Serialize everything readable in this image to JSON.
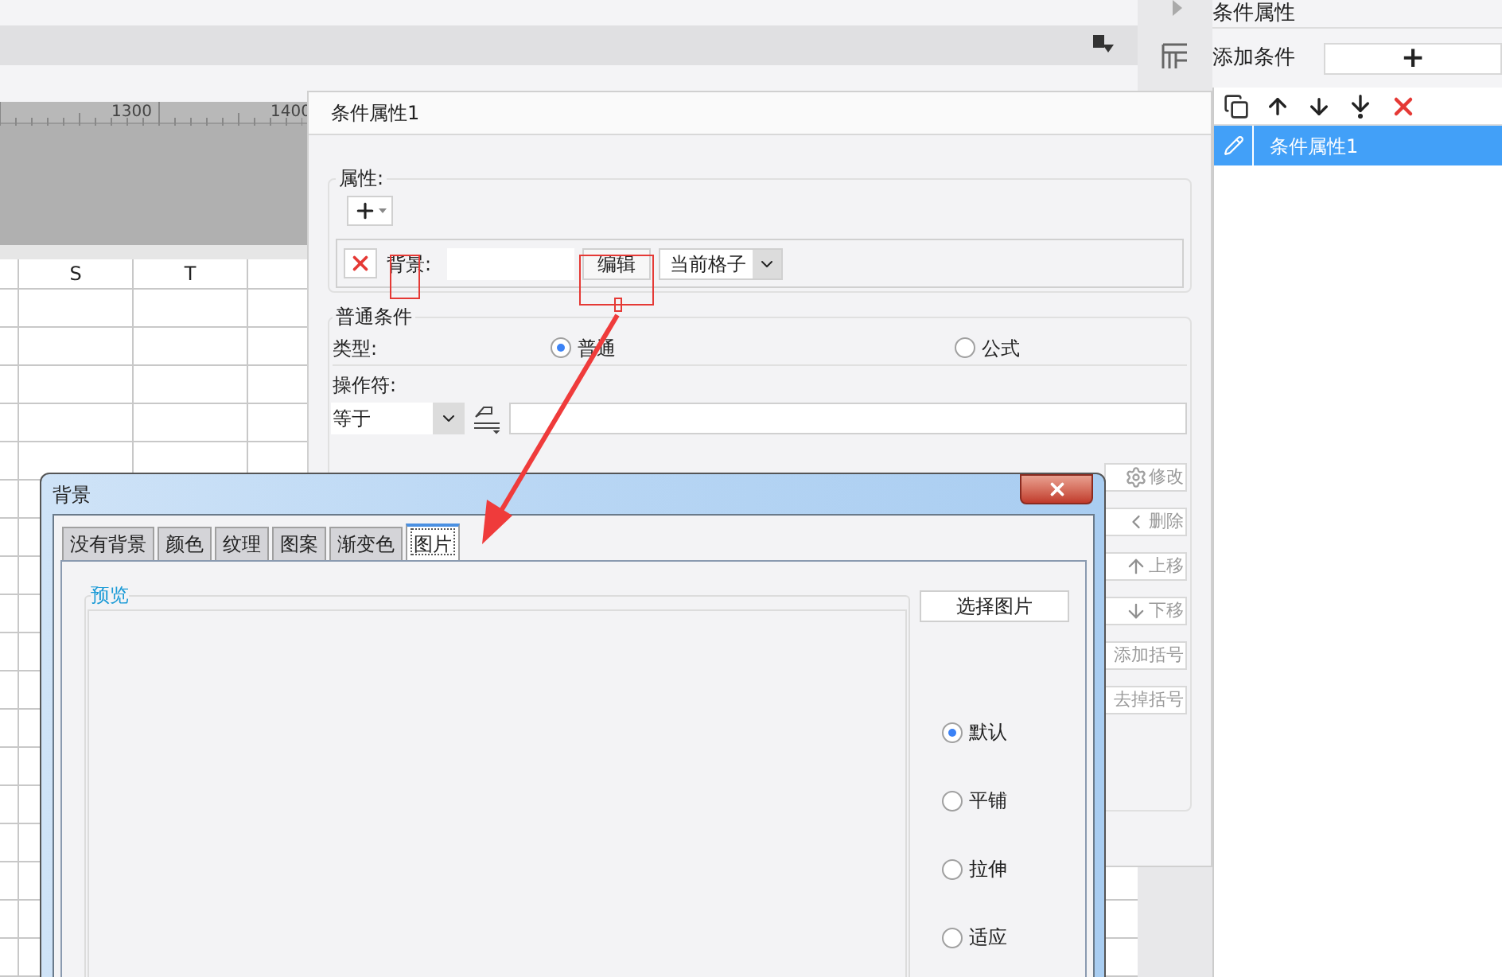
{
  "sheet": {
    "ruler_labels": [
      "1300",
      "1400"
    ],
    "columns": [
      "S",
      "T"
    ]
  },
  "side_panel": {
    "title": "条件属性",
    "add_label": "添加条件",
    "add_button": "+",
    "conditions": [
      {
        "label": "条件属性1",
        "selected": true
      }
    ]
  },
  "condition_dialog": {
    "title": "条件属性1",
    "attributes_label": "属性:",
    "attribute": {
      "label": "背景:",
      "edit_button": "编辑",
      "scope": "当前格子"
    },
    "general_label": "普通条件",
    "type_label": "类型:",
    "type_options": [
      {
        "label": "普通",
        "selected": true
      },
      {
        "label": "公式",
        "selected": false
      }
    ],
    "operator_label": "操作符:",
    "operator": "等于",
    "actions": [
      {
        "label": "修改",
        "kind": "gear",
        "disabled": true
      },
      {
        "label": "删除",
        "kind": "back",
        "disabled": true
      },
      {
        "label": "上移",
        "kind": "up",
        "disabled": true
      },
      {
        "label": "下移",
        "kind": "down",
        "disabled": true
      },
      {
        "label": "添加括号",
        "kind": "plain",
        "disabled": true
      },
      {
        "label": "去掉括号",
        "kind": "plain",
        "disabled": true
      }
    ]
  },
  "background_dialog": {
    "title": "背景",
    "tabs": [
      {
        "label": "没有背景",
        "selected": false
      },
      {
        "label": "颜色",
        "selected": false
      },
      {
        "label": "纹理",
        "selected": false
      },
      {
        "label": "图案",
        "selected": false
      },
      {
        "label": "渐变色",
        "selected": false
      },
      {
        "label": "图片",
        "selected": true
      }
    ],
    "preview_label": "预览",
    "choose_button": "选择图片",
    "modes": [
      {
        "label": "默认",
        "selected": true
      },
      {
        "label": "平铺",
        "selected": false
      },
      {
        "label": "拉伸",
        "selected": false
      },
      {
        "label": "适应",
        "selected": false
      }
    ]
  }
}
